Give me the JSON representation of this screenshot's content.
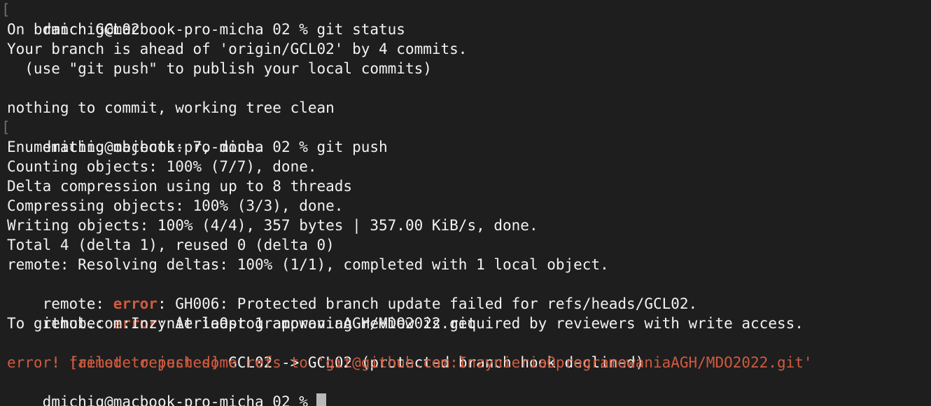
{
  "terminal": {
    "prompt": "dmichig@macbook-pro-micha 02 %",
    "bracket_mark": "[",
    "colors": {
      "background": "#1e1e1e",
      "text": "#f2f2f2",
      "error": "#cf5b40",
      "cursor": "#b9b9b9"
    },
    "lines": {
      "l1_cmd": " git status",
      "l2": "On branch GCL02",
      "l3": "Your branch is ahead of 'origin/GCL02' by 4 commits.",
      "l4": "  (use \"git push\" to publish your local commits)",
      "l5": "",
      "l6": "nothing to commit, working tree clean",
      "l7_cmd": " git push",
      "l8": "Enumerating objects: 7, done.",
      "l9": "Counting objects: 100% (7/7), done.",
      "l10": "Delta compression using up to 8 threads",
      "l11": "Compressing objects: 100% (3/3), done.",
      "l12": "Writing objects: 100% (4/4), 357 bytes | 357.00 KiB/s, done.",
      "l13": "Total 4 (delta 1), reused 0 (delta 0)",
      "l14": "remote: Resolving deltas: 100% (1/1), completed with 1 local object.",
      "l15_prefix": "remote: ",
      "l15_err": "error",
      "l15_rest": ": GH006: Protected branch update failed for refs/heads/GCL02.",
      "l16_prefix": "remote: ",
      "l16_err": "error",
      "l16_rest": ": At least 1 approving review is required by reviewers with write access.",
      "l17": "To github.com:InzynieriaOprogramowaniaAGH/MDO2022.git",
      "l18_red": " ! [remote rejected]",
      "l18_rest": " GCL02 -> GCL02 (protected branch hook declined)",
      "l19": "error: failed to push some refs to 'git@github.com:InzynieriaOprogramowaniaAGH/MDO2022.git'"
    }
  }
}
